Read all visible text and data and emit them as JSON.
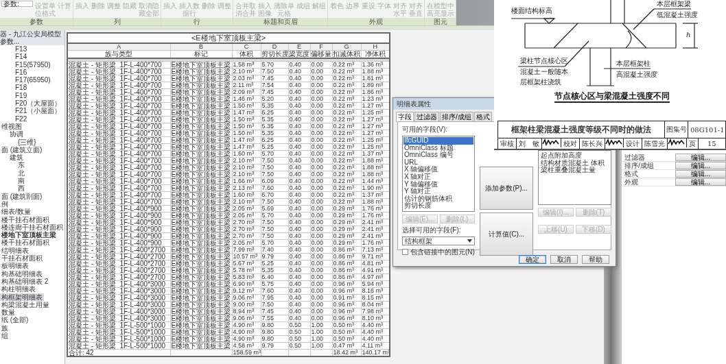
{
  "ribbon": {
    "parameter_dropdown": "参数:",
    "groups": [
      {
        "label": "参数",
        "buttons": [
          {
            "label": "设置单位格式",
            "disabled": true
          },
          {
            "label": "计算",
            "disabled": true
          }
        ]
      },
      {
        "label": "列",
        "buttons": [
          {
            "label": "插入",
            "disabled": true
          },
          {
            "label": "删除",
            "disabled": true
          },
          {
            "label": "调整",
            "disabled": true
          },
          {
            "label": "隐藏",
            "disabled": true
          },
          {
            "label": "取消隐藏全部",
            "disabled": true
          }
        ]
      },
      {
        "label": "行",
        "buttons": [
          {
            "label": "插入",
            "disabled": true
          },
          {
            "label": "插入数据行",
            "disabled": true
          },
          {
            "label": "删除",
            "disabled": true
          },
          {
            "label": "调整",
            "disabled": true
          }
        ]
      },
      {
        "label": "标题和页眉",
        "buttons": [
          {
            "label": "合并取消合并",
            "disabled": true
          },
          {
            "label": "插入图像",
            "disabled": true
          },
          {
            "label": "清除单元格",
            "disabled": true
          },
          {
            "label": "成组",
            "disabled": true
          },
          {
            "label": "解组",
            "disabled": true
          }
        ]
      },
      {
        "label": "外观",
        "buttons": [
          {
            "label": "着色",
            "disabled": true
          },
          {
            "label": "边界",
            "disabled": true
          },
          {
            "label": "重设",
            "disabled": true
          },
          {
            "label": "字体",
            "disabled": true
          },
          {
            "label": "对齐水平",
            "disabled": true
          },
          {
            "label": "对齐垂直",
            "disabled": true
          }
        ]
      },
      {
        "label": "图元",
        "buttons": [
          {
            "label": "在模型中高亮显示",
            "disabled": true
          }
        ]
      }
    ]
  },
  "project_browser": {
    "title": "器 - 九江公安局模型参数...",
    "levels": [
      {
        "label": "F13",
        "selected": false,
        "current": false
      },
      {
        "label": "F14",
        "selected": false,
        "current": false
      },
      {
        "label": "F15(57950)",
        "selected": false,
        "current": false
      },
      {
        "label": "F16",
        "selected": false,
        "current": false
      },
      {
        "label": "F17(65950)",
        "selected": false,
        "current": false
      },
      {
        "label": "F18",
        "selected": false,
        "current": false
      },
      {
        "label": "F19",
        "selected": false,
        "current": false
      },
      {
        "label": "F20（大屋面）",
        "selected": false,
        "current": false
      },
      {
        "label": "F21（小屋面）",
        "selected": false,
        "current": false
      },
      {
        "label": "F22",
        "selected": false,
        "current": false
      }
    ],
    "items": [
      {
        "label": "维视图",
        "selected": false,
        "current": false,
        "children": [
          {
            "label": "协调",
            "selected": false,
            "current": false,
            "children": [
              {
                "label": "{三维}",
                "selected": false,
                "current": false
              }
            ]
          }
        ]
      },
      {
        "label": "面 (建筑立面)",
        "selected": false,
        "current": false,
        "children": [
          {
            "label": "建筑",
            "selected": false,
            "current": false,
            "children": [
              {
                "label": "东",
                "selected": false,
                "current": false
              },
              {
                "label": "北",
                "selected": false,
                "current": false
              },
              {
                "label": "南",
                "selected": false,
                "current": false
              },
              {
                "label": "西",
                "selected": false,
                "current": false
              }
            ]
          }
        ]
      },
      {
        "label": "面 (建筑剖面)",
        "selected": false,
        "current": false
      },
      {
        "label": "例",
        "selected": false,
        "current": false
      },
      {
        "label": "细表/数量",
        "selected": false,
        "current": false
      },
      {
        "label": "楼干挂石材面积",
        "selected": false,
        "current": false
      },
      {
        "label": "楼连廊干挂石材面积",
        "selected": false,
        "current": false
      },
      {
        "label": "楼地下室顶板主梁",
        "selected": false,
        "current": true
      },
      {
        "label": "楼干挂石材面积",
        "selected": false,
        "current": false
      },
      {
        "label": "结明细表",
        "selected": false,
        "current": false
      },
      {
        "label": "干挂石材面积",
        "selected": false,
        "current": false
      },
      {
        "label": "板明细表",
        "selected": false,
        "current": false
      },
      {
        "label": "构基础明细表",
        "selected": false,
        "current": false
      },
      {
        "label": "构基础明细表 2",
        "selected": false,
        "current": false
      },
      {
        "label": "构柱明细表",
        "selected": false,
        "current": false
      },
      {
        "label": "构框架明细表",
        "selected": true,
        "current": false
      },
      {
        "label": "构梁混凝土用量",
        "selected": false,
        "current": false
      },
      {
        "label": "数量",
        "selected": false,
        "current": false
      },
      {
        "label": "纸 (全部)",
        "selected": false,
        "current": false
      },
      {
        "label": "族",
        "selected": false,
        "current": false
      },
      {
        "label": "组",
        "selected": false,
        "current": false
      }
    ]
  },
  "schedule": {
    "title": "<E楼地下室顶板主梁>",
    "column_letters": [
      "A",
      "B",
      "C",
      "D",
      "E",
      "F",
      "G",
      "H"
    ],
    "columns": [
      "族与类型",
      "标记",
      "体积",
      "剪切长度",
      "梁宽度",
      "偏移量",
      "扣减体积",
      "净体积"
    ],
    "rows": [
      [
        "混凝土 - 矩形梁  1F-L-400*700",
        "E楼地下室顶板主梁",
        "1.58 m³",
        "5.70",
        "0.40",
        "0.00",
        "0.22 m³",
        "1.36 m³"
      ],
      [
        "混凝土 - 矩形梁  1F-L-400*700",
        "E楼地下室顶板主梁",
        "2.10 m³",
        "7.50",
        "0.40",
        "0.00",
        "0.22 m³",
        "1.88 m³"
      ],
      [
        "混凝土 - 矩形梁  1F-L-400*700",
        "E楼地下室顶板主梁",
        "2.03 m³",
        "7.45",
        "0.40",
        "0.00",
        "0.22 m³",
        "1.81 m³"
      ],
      [
        "混凝土 - 矩形梁  1F-L-400*700",
        "E楼地下室顶板主梁",
        "2.11 m³",
        "7.54",
        "0.40",
        "0.00",
        "0.22 m³",
        "1.89 m³"
      ],
      [
        "混凝土 - 矩形梁  1F-L-400*700",
        "E楼地下室顶板主梁",
        "2.09 m³",
        "7.45",
        "0.40",
        "0.00",
        "0.22 m³",
        "1.86 m³"
      ],
      [
        "混凝土 - 矩形梁  1F-L-400*700",
        "E楼地下室顶板主梁",
        "1.46 m³",
        "5.20",
        "0.40",
        "0.00",
        "0.22 m³",
        "1.23 m³"
      ],
      [
        "混凝土 - 矩形梁  1F-L-400*700",
        "E楼地下室顶板主梁",
        "1.50 m³",
        "5.35",
        "0.40",
        "0.00",
        "0.22 m³",
        "1.27 m³"
      ],
      [
        "混凝土 - 矩形梁  1F-L-400*700",
        "E楼地下室顶板主梁",
        "1.47 m³",
        "5.25",
        "0.40",
        "0.00",
        "0.22 m³",
        "1.25 m³"
      ],
      [
        "混凝土 - 矩形梁  1F-L-400*700",
        "E楼地下室顶板主梁",
        "1.50 m³",
        "5.35",
        "0.40",
        "0.00",
        "0.22 m³",
        "1.27 m³"
      ],
      [
        "混凝土 - 矩形梁  1F-L-400*700",
        "E楼地下室顶板主梁",
        "1.50 m³",
        "5.35",
        "0.40",
        "0.00",
        "0.22 m³",
        "1.27 m³"
      ],
      [
        "混凝土 - 矩形梁  1F-L-400*700",
        "E楼地下室顶板主梁",
        "1.50 m³",
        "5.35",
        "0.40",
        "0.00",
        "0.22 m³",
        "1.27 m³"
      ],
      [
        "混凝土 - 矩形梁  1F-L-400*700",
        "E楼地下室顶板主梁",
        "1.47 m³",
        "5.25",
        "0.40",
        "0.00",
        "0.22 m³",
        "1.25 m³"
      ],
      [
        "混凝土 - 矩形梁  1F-L-400*700",
        "E楼地下室顶板主梁",
        "1.47 m³",
        "5.25",
        "0.40",
        "0.00",
        "0.22 m³",
        "1.25 m³"
      ],
      [
        "混凝土 - 矩形梁  1F-L-400*700",
        "E楼地下室顶板主梁",
        "1.60 m³",
        "5.70",
        "0.40",
        "0.00",
        "0.22 m³",
        "1.37 m³"
      ],
      [
        "混凝土 - 矩形梁  1F-L-400*700",
        "E楼地下室顶板主梁",
        "2.10 m³",
        "7.50",
        "0.40",
        "0.00",
        "0.22 m³",
        "1.88 m³"
      ],
      [
        "混凝土 - 矩形梁  1F-L-400*700",
        "E楼地下室顶板主梁",
        "2.10 m³",
        "7.50",
        "0.40",
        "0.00",
        "0.22 m³",
        "1.88 m³"
      ],
      [
        "混凝土 - 矩形梁  1F-L-400*700",
        "E楼地下室顶板主梁",
        "2.10 m³",
        "7.50",
        "0.40",
        "0.00",
        "0.22 m³",
        "1.88 m³"
      ],
      [
        "混凝土 - 矩形梁  1F-L-400*700",
        "E楼地下室顶板主梁",
        "1.66 m³",
        "6.09",
        "0.40",
        "0.00",
        "0.22 m³",
        "1.44 m³"
      ],
      [
        "混凝土 - 矩形梁  1F-L-400*700",
        "E楼地下室顶板主梁",
        "2.13 m³",
        "7.60",
        "0.40",
        "0.00",
        "0.22 m³",
        "1.90 m³"
      ],
      [
        "混凝土 - 矩形梁  1F-L-400*700",
        "E楼地下室顶板主梁",
        "1.60 m³",
        "5.70",
        "0.40",
        "0.00",
        "0.22 m³",
        "1.37 m³"
      ],
      [
        "混凝土 - 矩形梁  1F-L-400*700",
        "E楼地下室顶板主梁",
        "2.10 m³",
        "7.50",
        "0.40",
        "0.00",
        "0.22 m³",
        "1.88 m³"
      ],
      [
        "混凝土 - 矩形梁  1F-L-400*900",
        "E楼地下室顶板主梁",
        "2.05 m³",
        "5.69",
        "0.40",
        "0.00",
        "0.29 m³",
        "1.76 m³"
      ],
      [
        "混凝土 - 矩形梁  1F-L-400*900",
        "E楼地下室顶板主梁",
        "2.05 m³",
        "5.70",
        "0.40",
        "0.00",
        "0.29 m³",
        "1.76 m³"
      ],
      [
        "混凝土 - 矩形梁  1F-L-400*900",
        "E楼地下室顶板主梁",
        "2.70 m³",
        "7.50",
        "0.40",
        "0.00",
        "0.29 m³",
        "2.41 m³"
      ],
      [
        "混凝土 - 矩形梁  1F-L-400*900",
        "E楼地下室顶板主梁",
        "2.70 m³",
        "7.50",
        "0.40",
        "0.00",
        "0.29 m³",
        "2.41 m³"
      ],
      [
        "混凝土 - 矩形梁  1F-L-400*900",
        "E楼地下室顶板主梁",
        "2.70 m³",
        "7.50",
        "0.40",
        "0.00",
        "0.29 m³",
        "2.41 m³"
      ],
      [
        "混凝土 - 矩形梁  1F-L-400*900",
        "E楼地下室顶板主梁",
        "2.05 m³",
        "5.70",
        "0.40",
        "0.00",
        "0.29 m³",
        "1.76 m³"
      ],
      [
        "混凝土 - 矩形梁  1F-L-400*2700",
        "E楼地下室顶板主梁",
        "7.99 m³",
        "7.40",
        "0.40",
        "0.00",
        "0.86 m³",
        "7.13 m³"
      ],
      [
        "混凝土 - 矩形梁  1F-L-400*2700",
        "E楼地下室顶板主梁",
        "10.57 m³",
        "9.79",
        "0.40",
        "0.00",
        "0.86 m³",
        "9.71 m³"
      ],
      [
        "混凝土 - 矩形梁  1F-L-400*2700",
        "E楼地下室顶板主梁",
        "5.67 m³",
        "5.25",
        "0.40",
        "0.00",
        "0.86 m³",
        "4.81 m³"
      ],
      [
        "混凝土 - 矩形梁  1F-L-400*2700",
        "E楼地下室顶板主梁",
        "5.78 m³",
        "5.35",
        "0.40",
        "0.00",
        "0.86 m³",
        "4.91 m³"
      ],
      [
        "混凝土 - 矩形梁  1F-L-400*2700",
        "E楼地下室顶板主梁",
        "5.83 m³",
        "5.40",
        "0.40",
        "0.00",
        "0.86 m³",
        "4.97 m³"
      ],
      [
        "混凝土 - 矩形梁  1F-L-400*3000",
        "E楼地下室顶板主梁",
        "6.90 m³",
        "5.75",
        "0.40",
        "0.00",
        "0.96 m³",
        "5.94 m³"
      ],
      [
        "混凝土 - 矩形梁  1F-L-400*3000",
        "E楼地下室顶板主梁",
        "9.12 m³",
        "7.60",
        "0.40",
        "0.00",
        "0.96 m³",
        "8.16 m³"
      ],
      [
        "混凝土 - 矩形梁  1F-L-400*3000",
        "E楼地下室顶板主梁",
        "9.06 m³",
        "7.95",
        "0.40",
        "0.00",
        "0.91 m³",
        "8.15 m³"
      ],
      [
        "混凝土 - 矩形梁  1F-L-400*3000",
        "E楼地下室顶板主梁",
        "9.00 m³",
        "7.50",
        "0.40",
        "0.00",
        "0.96 m³",
        "8.04 m³"
      ],
      [
        "混凝土 - 矩形梁  1F-L-400*3000",
        "E楼地下室顶板主梁",
        "8.94 m³",
        "7.45",
        "0.40",
        "0.00",
        "0.96 m³",
        "7.98 m³"
      ],
      [
        "混凝土 - 矩形梁  1F-L-400*3000",
        "E楼地下室顶板主梁",
        "9.06 m³",
        "7.55",
        "0.40",
        "0.00",
        "0.96 m³",
        "8.10 m³"
      ],
      [
        "混凝土 - 矩形梁  1F-L-500*1000",
        "E楼地下室顶板主梁",
        "4.90 m³",
        "9.80",
        "0.50",
        "1.00",
        "0.50 m³",
        "4.40 m³"
      ],
      [
        "混凝土 - 矩形梁  1F-L-500*1000",
        "E楼地下室顶板主梁",
        "4.90 m³",
        "9.80",
        "0.50",
        "1.00",
        "0.50 m³",
        "4.40 m³"
      ],
      [
        "混凝土 - 矩形梁  1F-L-500*1000",
        "E楼地下室顶板主梁",
        "4.90 m³",
        "9.80",
        "0.50",
        "1.00",
        "0.50 m³",
        "4.40 m³"
      ],
      [
        "混凝土 - 矩形梁  1F-L-500*1000",
        "E楼地下室顶板主梁",
        "4.58 m³",
        "9.79",
        "0.50",
        "1.00",
        "0.47 m³",
        "4.11 m³"
      ]
    ],
    "totals": {
      "A": "合计: 42",
      "C": "158.59 m³",
      "G": "18.42 m³",
      "H": "140.17 m³"
    }
  },
  "dialog": {
    "title": "明细表属性",
    "tabs": [
      {
        "label": "字段",
        "selected": true
      },
      {
        "label": "过滤器",
        "selected": false
      },
      {
        "label": "排序/成组",
        "selected": false
      },
      {
        "label": "格式",
        "selected": false
      }
    ],
    "available_label": "可用的字段(V):",
    "available_fields": [
      {
        "label": "IfcGUID",
        "selected": true
      },
      {
        "label": "OmniClass 标题",
        "selected": false
      },
      {
        "label": "OmniClass 编号",
        "selected": false
      },
      {
        "label": "URL",
        "selected": false
      },
      {
        "label": "X 轴偏移值",
        "selected": false
      },
      {
        "label": "X 轴对正",
        "selected": false
      },
      {
        "label": "Y 轴偏移值",
        "selected": false
      },
      {
        "label": "Y 轴对正",
        "selected": false
      },
      {
        "label": "估计的钢筋体积",
        "selected": false
      },
      {
        "label": "剪切长度",
        "selected": false
      }
    ],
    "left_buttons": [
      {
        "label": "编辑(E)...",
        "disabled": true
      },
      {
        "label": "删除(L)",
        "disabled": true
      }
    ],
    "category_label": "选择可用的字段(F):",
    "category": "结构框架",
    "include_linked": {
      "label": "包含链接中的图元(N)",
      "checked": false
    },
    "middle_buttons": [
      {
        "label": "添加参数(P)...",
        "disabled": false
      },
      {
        "label": "计算值(C)...",
        "disabled": false
      }
    ],
    "scheduled_fields": [
      {
        "label": "起点附加高度",
        "selected": false
      },
      {
        "label": "结构材质混凝土 体积",
        "selected": false
      },
      {
        "label": "梁柱重叠混凝土量",
        "selected": false
      }
    ],
    "right_buttons": [
      {
        "label": "编辑(I)...",
        "disabled": true
      },
      {
        "label": "删除(T)",
        "disabled": true
      }
    ],
    "move_buttons": [
      {
        "label": "上移(U)",
        "disabled": true
      },
      {
        "label": "下移(D)",
        "disabled": true
      }
    ],
    "footer_buttons": [
      {
        "label": "确定",
        "default": true
      },
      {
        "label": "取消",
        "default": false
      },
      {
        "label": "帮助",
        "default": false
      }
    ]
  },
  "properties": {
    "rows": [
      {
        "label": "过滤器",
        "button": "编辑..."
      },
      {
        "label": "排序/成组",
        "button": "编辑..."
      },
      {
        "label": "格式",
        "button": "编辑..."
      },
      {
        "label": "外观",
        "button": "编辑..."
      }
    ]
  },
  "detail_drawing": {
    "labels": [
      "楼面结构标高",
      "本层框架梁",
      "低混凝土强度",
      "h",
      "梁柱节点核心区",
      "混凝土一般随本",
      "层框架柱浇筑",
      "本层框架柱",
      "高混凝土强度"
    ],
    "caption": "节点核心区与梁混凝土强度不同",
    "title_block": {
      "title": "框架柱梁混凝土强度等级不同时的做法",
      "atlas_label": "图集号",
      "atlas_number": "08G101-1",
      "cells": [
        {
          "kind": "text",
          "text": "审核"
        },
        {
          "kind": "text",
          "text": "刘　敏"
        },
        {
          "kind": "signature"
        },
        {
          "kind": "text",
          "text": "校对"
        },
        {
          "kind": "text",
          "text": "陈长兴"
        },
        {
          "kind": "signature"
        },
        {
          "kind": "text",
          "text": "设计"
        },
        {
          "kind": "text",
          "text": "陈雪光"
        },
        {
          "kind": "signature"
        },
        {
          "kind": "text",
          "text": "页"
        },
        {
          "kind": "text",
          "text": "15"
        }
      ]
    }
  }
}
